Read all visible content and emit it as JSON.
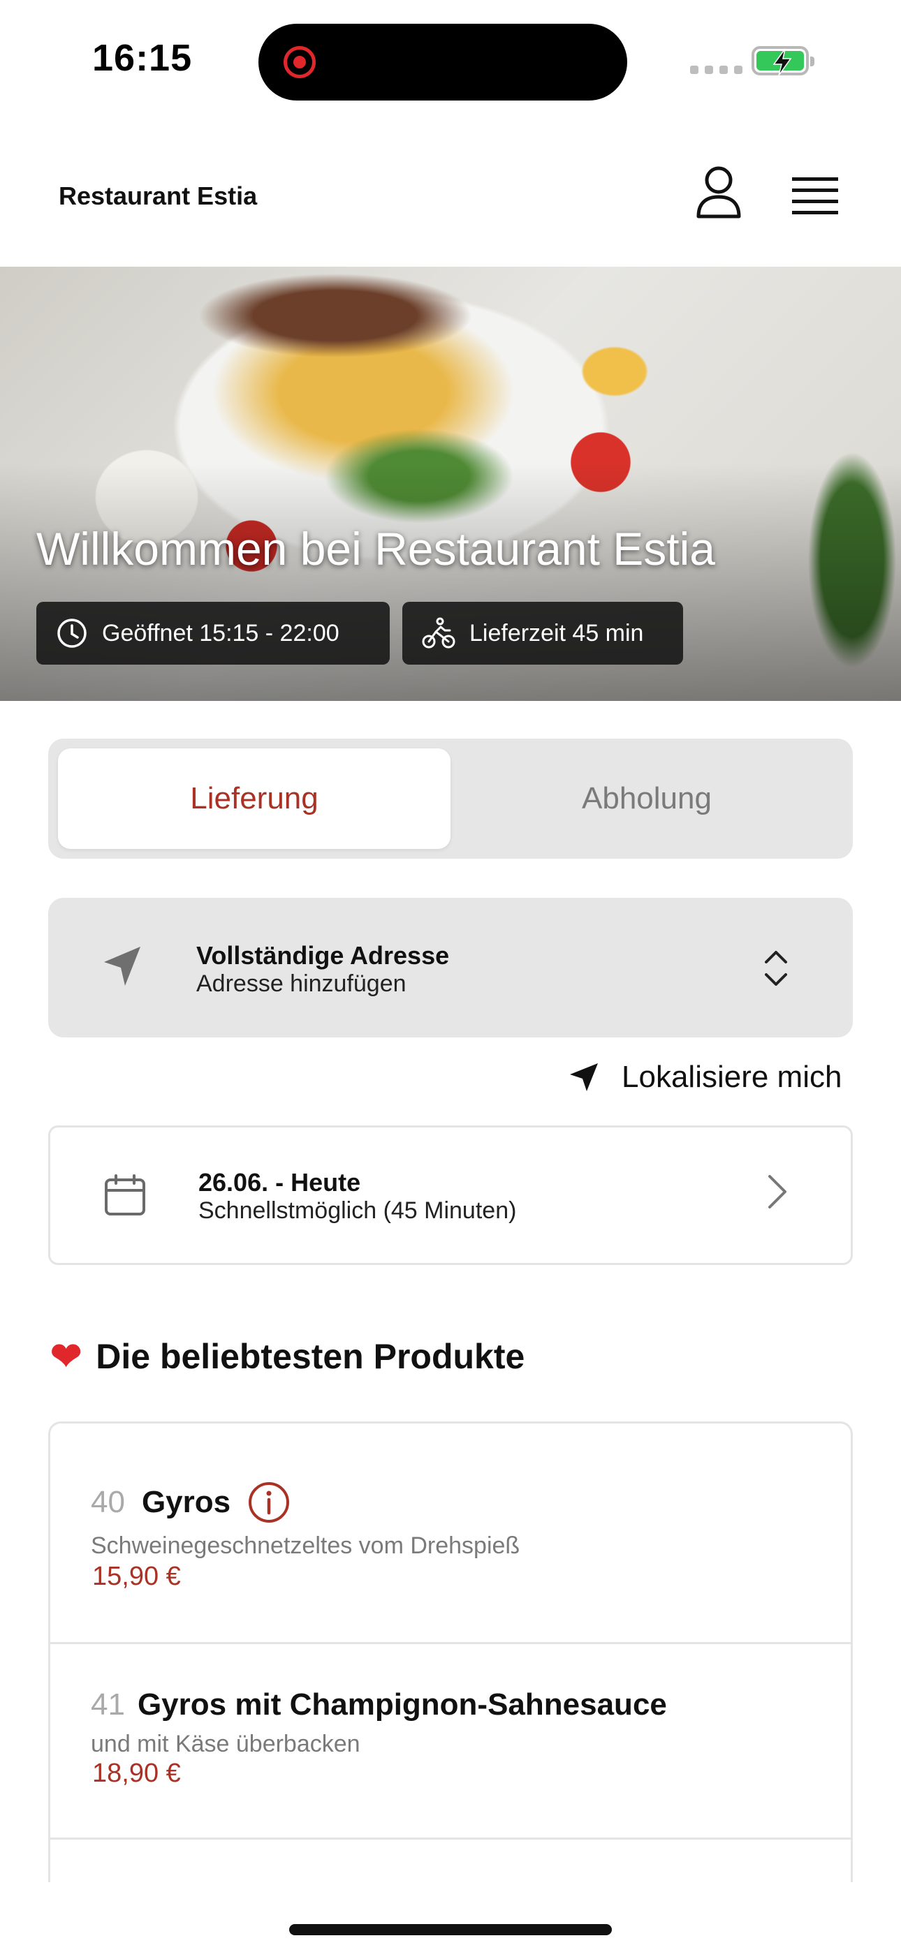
{
  "status_bar": {
    "time": "16:15"
  },
  "header": {
    "brand": "Restaurant Estia"
  },
  "hero": {
    "title": "Willkommen bei Restaurant Estia",
    "opening_hours": "Geöffnet 15:15 - 22:00",
    "delivery_time": "Lieferzeit 45 min"
  },
  "order_mode": {
    "options": [
      "Lieferung",
      "Abholung"
    ],
    "selected": "Lieferung"
  },
  "address": {
    "title": "Vollständige Adresse",
    "subtitle": "Adresse hinzufügen",
    "locate_label": "Lokalisiere mich"
  },
  "schedule": {
    "date": "26.06. - Heute",
    "time": "Schnellstmöglich (45 Minuten)"
  },
  "popular": {
    "title": "Die beliebtesten Produkte",
    "products": [
      {
        "number": "40",
        "name": "Gyros",
        "description": "Schweinegeschnetzeltes vom Drehspieß",
        "price": "15,90 €"
      },
      {
        "number": "41",
        "name": "Gyros mit Champignon-Sahnesauce",
        "description": "und mit Käse überbacken",
        "price": "18,90 €"
      }
    ]
  },
  "colors": {
    "accent": "#a93225",
    "segment_bg": "#e6e6e6",
    "muted_text": "#7a7a7a"
  },
  "icons": [
    "user-icon",
    "menu-icon",
    "clock-icon",
    "bicycle-icon",
    "navigation-arrow-icon",
    "chevron-up-down-icon",
    "calendar-icon",
    "chevron-right-icon",
    "heart-icon",
    "info-icon"
  ]
}
